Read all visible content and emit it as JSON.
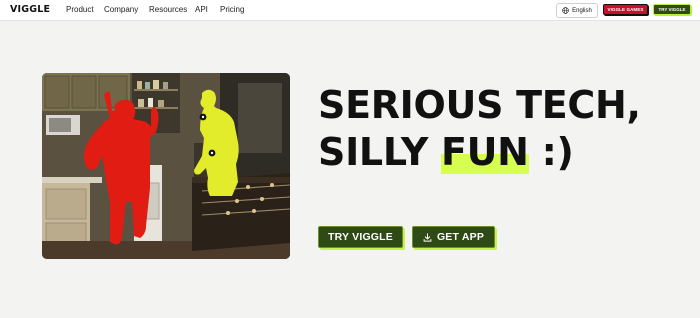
{
  "nav": {
    "logo": "VIGGLE",
    "links": [
      "Product",
      "Company",
      "Resources",
      "API",
      "Pricing"
    ],
    "language": "English",
    "games_button": "VIGGLE GAMES",
    "try_button": "TRY VIGGLE"
  },
  "hero": {
    "headline_line1": "SERIOUS TECH,",
    "headline_line2_prefix": "SILLY ",
    "headline_line2_accent": "FUN",
    "headline_line2_suffix": " :)",
    "primary_cta": "TRY VIGGLE",
    "secondary_cta": "GET APP"
  },
  "icons": {
    "language": "globe-icon",
    "download": "download-icon"
  },
  "colors": {
    "accent_lime": "#d6ff4f",
    "button_dark_green": "#2e4a16",
    "games_red": "#c8102e",
    "mask_red": "#e11c12",
    "mask_yellow": "#e2ec2a"
  }
}
